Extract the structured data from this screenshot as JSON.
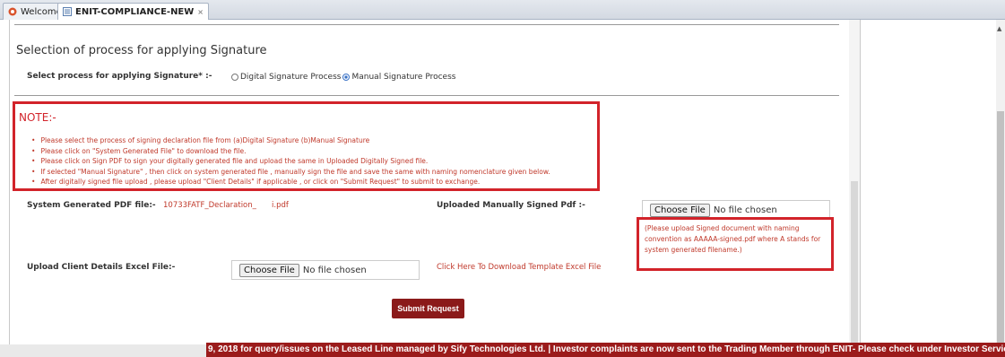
{
  "tabs": [
    {
      "label": "Welcome",
      "icon": "welcome-icon"
    },
    {
      "label": "ENIT-COMPLIANCE-NEW",
      "icon": "form-icon",
      "close": "×"
    }
  ],
  "section_title": "Selection of process for applying Signature",
  "signature": {
    "label": "Select process for applying Signature* :-",
    "options": [
      "Digital Signature Process",
      "Manual Signature Process"
    ],
    "selected": "Manual Signature Process"
  },
  "note": {
    "title": "NOTE:-",
    "items": [
      "Please select the process of signing declaration file from (a)Digital Signature (b)Manual Signature",
      "Please click on \"System Generated File\" to download the file.",
      "Please click on Sign PDF to sign your digitally generated file and upload the same in Uploaded Digitally Signed file.",
      "If selected \"Manual Signature\" , then click on system generated file , manually sign the file and save the same with naming nomenclature given below.",
      "After digitally signed file upload , please upload \"Client Details\" if applicable , or click on \"Submit Request\" to submit to exchange."
    ]
  },
  "system_pdf": {
    "label": "System Generated PDF file:-",
    "file_prefix": "10733FATF_Declaration_",
    "file_suffix": "i.pdf"
  },
  "uploaded_pdf": {
    "label": "Uploaded Manually Signed Pdf :-",
    "button": "Choose File",
    "value": "No file chosen",
    "hint": "(Please upload Signed document with naming convention as AAAAA-signed.pdf where A stands for system generated filename.)"
  },
  "client_excel": {
    "label": "Upload Client Details Excel File:-",
    "button": "Choose File",
    "value": "No file chosen",
    "template_link": "Click Here To Download Template Excel File"
  },
  "submit_label": "Submit Request",
  "ticker": "9, 2018 for query/issues on the Leased Line managed by Sify Technologies Ltd. | Investor complaints are now sent to the Trading Member through ENIT- Please check under Investor Service",
  "colors": {
    "accent_red": "#d2232a",
    "button": "#8b1a1a"
  }
}
